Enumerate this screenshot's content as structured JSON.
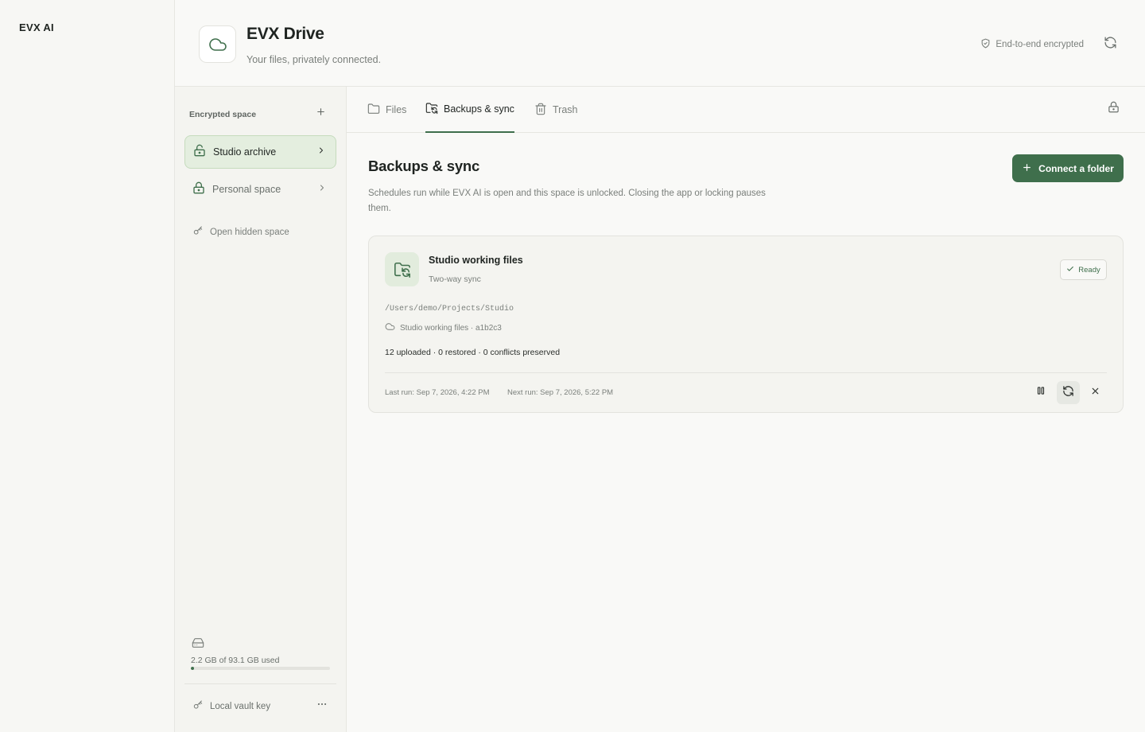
{
  "app": {
    "brand": "EVX AI"
  },
  "header": {
    "title": "EVX Drive",
    "subtitle": "Your files, privately connected.",
    "encryption": "End-to-end encrypted",
    "icons": {
      "logo": "cloud-icon",
      "encryption": "shield-check-icon",
      "refresh": "refresh-icon"
    }
  },
  "sidebar": {
    "section_label": "Encrypted space",
    "items": [
      {
        "label": "Studio archive",
        "icon": "unlock-icon",
        "active": true
      },
      {
        "label": "Personal space",
        "icon": "lock-icon",
        "active": false
      }
    ],
    "hidden_space": "Open hidden space",
    "storage": {
      "text": "2.2 GB of 93.1 GB used",
      "fraction": 0.0236
    },
    "vault_key": "Local vault key"
  },
  "tabs": [
    {
      "label": "Files",
      "icon": "folder-icon",
      "active": false
    },
    {
      "label": "Backups & sync",
      "icon": "folder-sync-icon",
      "active": true
    },
    {
      "label": "Trash",
      "icon": "trash-icon",
      "active": false
    }
  ],
  "main": {
    "title": "Backups & sync",
    "description": "Schedules run while EVX AI is open and this space is unlocked. Closing the app or locking pauses them.",
    "connect_label": "Connect a folder"
  },
  "sync_job": {
    "name": "Studio working files",
    "mode": "Two-way sync",
    "status": "Ready",
    "local_path": "/Users/demo/Projects/Studio",
    "remote": "Studio working files · a1b2c3",
    "stats": "12 uploaded · 0 restored · 0 conflicts preserved",
    "last_run": "Last run: Sep 7, 2026, 4:22 PM",
    "next_run": "Next run: Sep 7, 2026, 5:22 PM"
  },
  "colors": {
    "accent": "#3f6f4c",
    "accent_soft": "#e4eedf",
    "border": "#e3e3de",
    "muted_text": "#7a7f7b"
  }
}
